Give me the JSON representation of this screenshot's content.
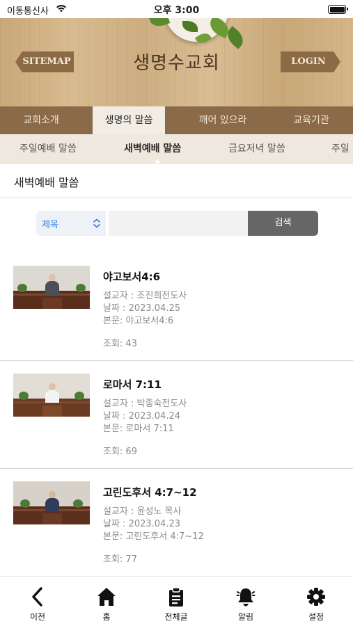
{
  "status_bar": {
    "carrier": "이동통신사",
    "time": "오후 3:00"
  },
  "header": {
    "title": "생명수교회",
    "sitemap_label": "SITEMAP",
    "login_label": "LOGIN"
  },
  "main_tabs": [
    {
      "label": "교회소개"
    },
    {
      "label": "생명의 말씀"
    },
    {
      "label": "깨어 있으라"
    },
    {
      "label": "교육기관"
    }
  ],
  "sub_tabs": [
    {
      "label": "주일예배 말씀"
    },
    {
      "label": "새벽예배 말씀"
    },
    {
      "label": "금요저녁 말씀"
    },
    {
      "label": "주일"
    }
  ],
  "section": {
    "title": "새벽예배 말씀"
  },
  "search": {
    "select_value": "제목",
    "input_value": "",
    "button_label": "검색"
  },
  "sermons": [
    {
      "title": "야고보서4:6",
      "preacher": "설교자 : 조진희전도사",
      "date": "날짜 : 2023.04.25",
      "passage": "본문: 야고보서4:6",
      "views": "조회: 43"
    },
    {
      "title": "로마서 7:11",
      "preacher": "설교자 : 박종숙전도사",
      "date": "날짜 : 2023.04.24",
      "passage": "본문: 로마서 7:11",
      "views": "조회: 69"
    },
    {
      "title": "고린도후서 4:7~12",
      "preacher": "설교자 : 윤성노 목사",
      "date": "날짜 : 2023.04.23",
      "passage": "본문: 고린도후서 4:7~12",
      "views": "조회: 77"
    }
  ],
  "bottom_nav": [
    {
      "label": "이전",
      "icon": "chevron-left-icon"
    },
    {
      "label": "홈",
      "icon": "home-icon"
    },
    {
      "label": "전체글",
      "icon": "clipboard-icon"
    },
    {
      "label": "알림",
      "icon": "bell-icon"
    },
    {
      "label": "설정",
      "icon": "gear-icon"
    }
  ],
  "colors": {
    "header_tab_bg": "#8b6a49",
    "sub_tab_bg": "#efe8de",
    "search_button": "#666666",
    "select_text": "#2f80ed"
  }
}
